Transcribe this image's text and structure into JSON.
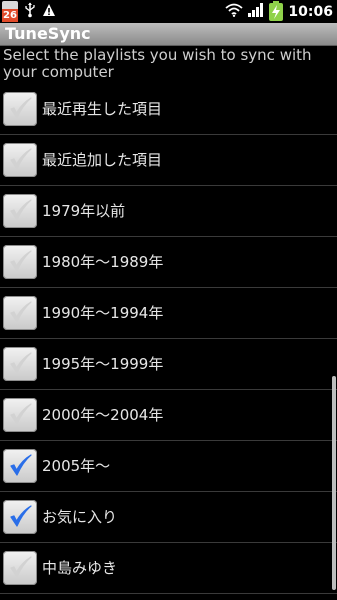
{
  "status_bar": {
    "calendar_month": "",
    "calendar_day": "26",
    "time": "10:06",
    "icons": [
      "usb-icon",
      "alert-icon",
      "wifi-icon",
      "signal-icon",
      "battery-icon"
    ]
  },
  "app": {
    "title": "TuneSync",
    "instructions": "Select the playlists you wish to sync with your computer"
  },
  "colors": {
    "check_checked": "#2a6ee8",
    "check_unchecked": "#d2d2d2",
    "title_bar": "#a4a4a4"
  },
  "playlists": [
    {
      "label": "最近再生した項目",
      "checked": false
    },
    {
      "label": "最近追加した項目",
      "checked": false
    },
    {
      "label": "1979年以前",
      "checked": false
    },
    {
      "label": "1980年～1989年",
      "checked": false
    },
    {
      "label": "1990年～1994年",
      "checked": false
    },
    {
      "label": "1995年～1999年",
      "checked": false
    },
    {
      "label": "2000年～2004年",
      "checked": false
    },
    {
      "label": "2005年～",
      "checked": true
    },
    {
      "label": "お気に入り",
      "checked": true
    },
    {
      "label": "中島みゆき",
      "checked": false
    }
  ]
}
